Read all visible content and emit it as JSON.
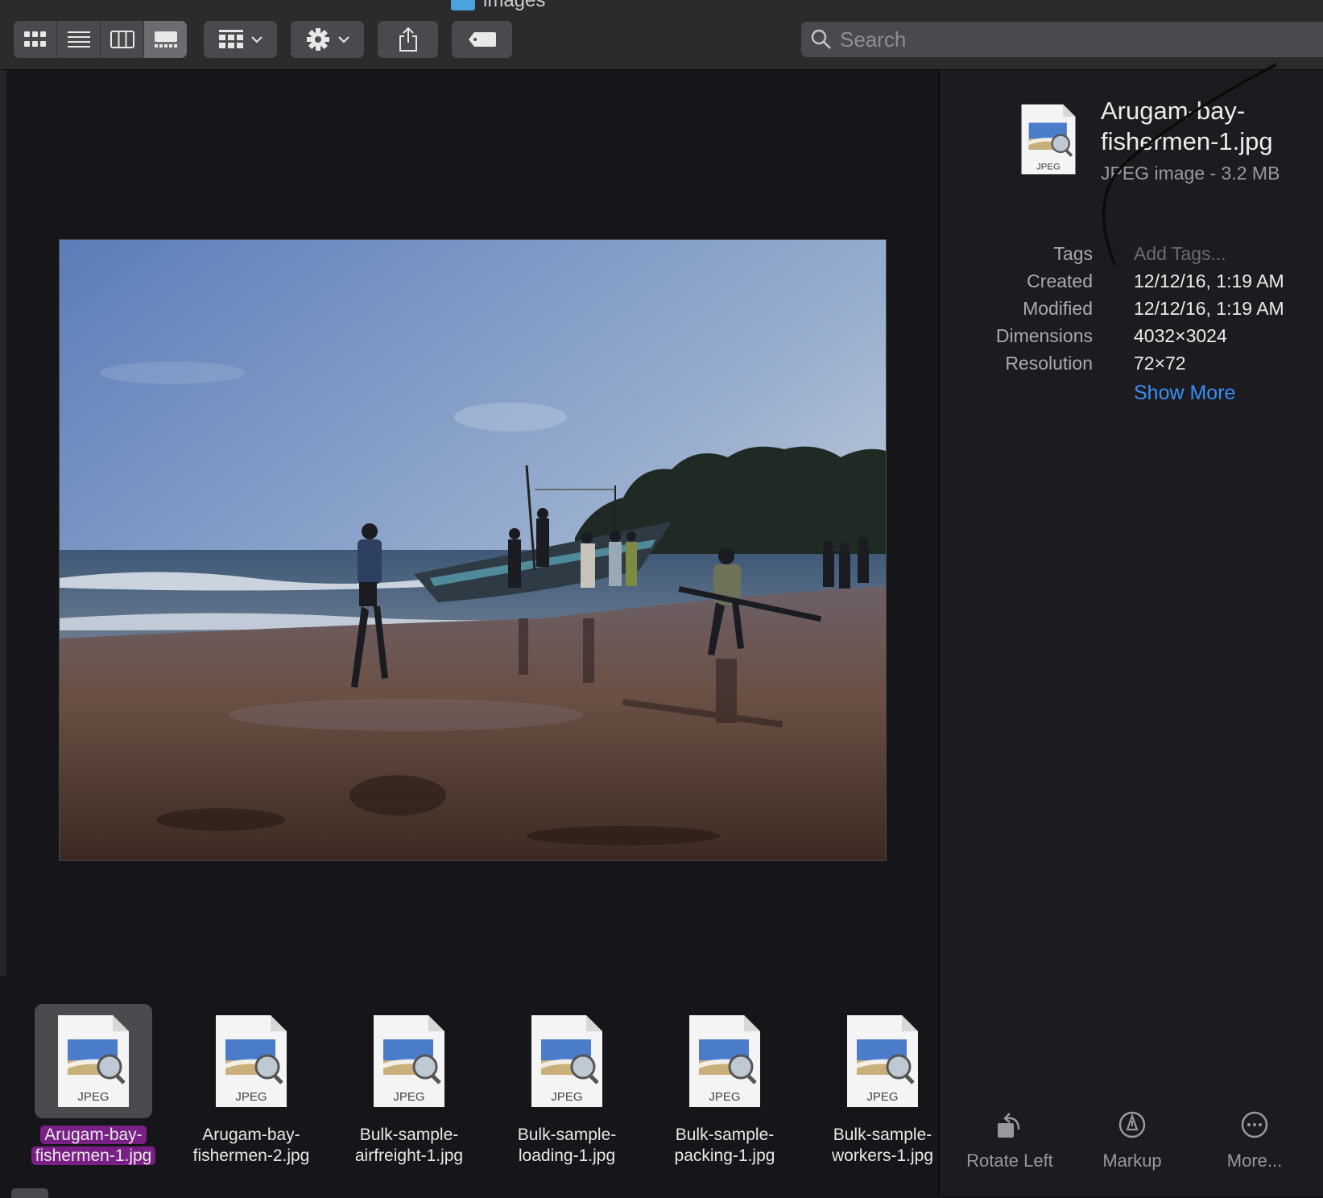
{
  "window": {
    "title": "images"
  },
  "toolbar": {
    "view_modes": [
      "icon-view",
      "list-view",
      "column-view",
      "gallery-view"
    ],
    "active_view": "gallery-view",
    "search": {
      "placeholder": "Search",
      "value": ""
    }
  },
  "preview": {
    "file": "Arugam-bay-fishermen-1.jpg"
  },
  "strip": {
    "items": [
      {
        "line1": "Arugam-bay-",
        "line2": "fishermen-1.jpg",
        "badge": "JPEG",
        "selected": true
      },
      {
        "line1": "Arugam-bay-",
        "line2": "fishermen-2.jpg",
        "badge": "JPEG",
        "selected": false
      },
      {
        "line1": "Bulk-sample-",
        "line2": "airfreight-1.jpg",
        "badge": "JPEG",
        "selected": false
      },
      {
        "line1": "Bulk-sample-",
        "line2": "loading-1.jpg",
        "badge": "JPEG",
        "selected": false
      },
      {
        "line1": "Bulk-sample-",
        "line2": "packing-1.jpg",
        "badge": "JPEG",
        "selected": false
      },
      {
        "line1": "Bulk-sample-",
        "line2": "workers-1.jpg",
        "badge": "JPEG",
        "selected": false
      }
    ]
  },
  "inspector": {
    "icon_badge": "JPEG",
    "title_line1": "Arugam-bay-",
    "title_line2": "fishermen-1.jpg",
    "subtitle": "JPEG image - 3.2 MB",
    "tags": {
      "label": "Tags",
      "placeholder": "Add Tags..."
    },
    "created": {
      "label": "Created",
      "value": "12/12/16, 1:19 AM"
    },
    "modified": {
      "label": "Modified",
      "value": "12/12/16, 1:19 AM"
    },
    "dimensions": {
      "label": "Dimensions",
      "value": "4032×3024"
    },
    "resolution": {
      "label": "Resolution",
      "value": "72×72"
    },
    "show_more": "Show More",
    "actions": {
      "rotate_left": "Rotate Left",
      "markup": "Markup",
      "more": "More..."
    }
  },
  "colors": {
    "accent": "#3a8ef6",
    "selection": "#7a1f86",
    "toolbar_bg": "#2b2b2e",
    "window_bg": "#16161a"
  }
}
